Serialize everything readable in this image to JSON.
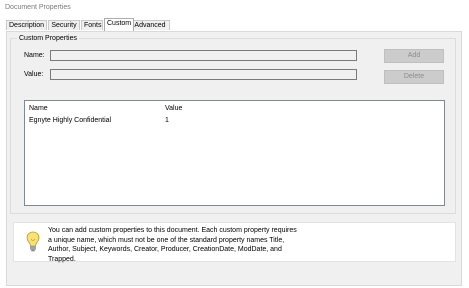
{
  "window": {
    "title": "Document Properties"
  },
  "tabs": [
    {
      "label": "Description",
      "active": false
    },
    {
      "label": "Security",
      "active": false
    },
    {
      "label": "Fonts",
      "active": false
    },
    {
      "label": "Custom",
      "active": true
    },
    {
      "label": "Advanced",
      "active": false
    }
  ],
  "custom": {
    "group_label": "Custom Properties",
    "name_label": "Name:",
    "name_value": "",
    "value_label": "Value:",
    "value_value": "",
    "add_label": "Add",
    "delete_label": "Delete",
    "columns": [
      "Name",
      "Value"
    ],
    "rows": [
      {
        "name": "Egnyte Highly Confidential",
        "value": "1"
      }
    ]
  },
  "info": {
    "icon": "lightbulb-icon",
    "lines": [
      "You can add custom properties to this document. Each custom property requires",
      "a unique name, which must not be one of the standard property names Title,",
      "Author, Subject, Keywords, Creator, Producer, CreationDate, ModDate, and",
      "Trapped."
    ]
  }
}
